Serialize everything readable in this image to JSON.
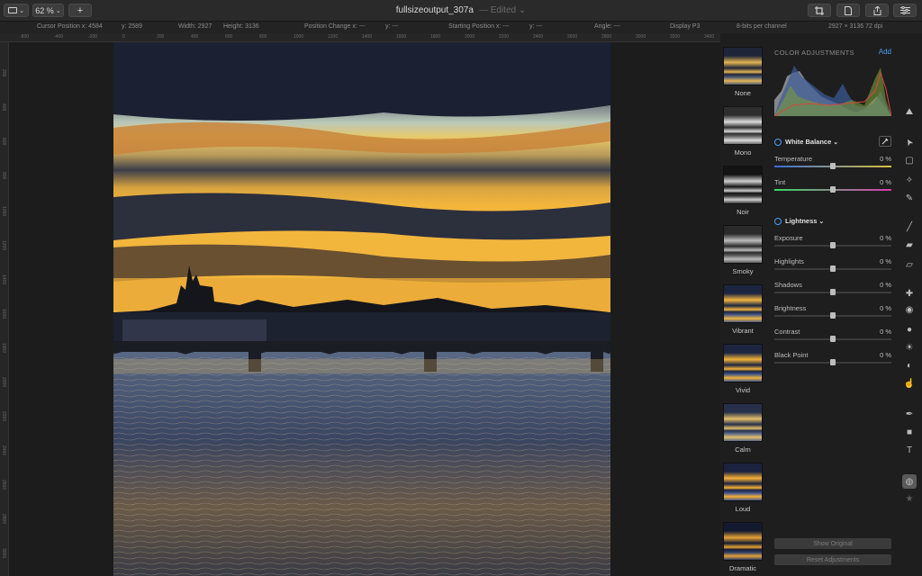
{
  "toolbar": {
    "zoom_label": "62 %",
    "zoom_caret": "⌄",
    "add_label": "+",
    "title": "fullsizeoutput_307a",
    "edited": "— Edited ⌄"
  },
  "info": {
    "cursor": "Cursor Position x: 4584",
    "cursor_y": "y: 2589",
    "width": "Width: 2927",
    "height": "Height: 3136",
    "pos_change": "Position Change x: ---",
    "pos_change_y": "y: ---",
    "start_pos": "Starting Position x: ---",
    "start_pos_y": "y: ---",
    "angle": "Angle: ---",
    "display": "Display P3",
    "bits": "8-bits per channel",
    "dims": "2927 × 3136 72 dpi"
  },
  "ruler": {
    "h": [
      "-800",
      "-400",
      "-200",
      "0",
      "200",
      "400",
      "600",
      "800",
      "1000",
      "1200",
      "1400",
      "1600",
      "1800",
      "2000",
      "2200",
      "2400",
      "2600",
      "2800",
      "3000",
      "3200",
      "3400"
    ],
    "v": [
      "200",
      "400",
      "600",
      "800",
      "1000",
      "1200",
      "1400",
      "1600",
      "1800",
      "2000",
      "2200",
      "2400",
      "2600",
      "2800",
      "3000"
    ]
  },
  "presets": [
    {
      "label": "None"
    },
    {
      "label": "Mono"
    },
    {
      "label": "Noir"
    },
    {
      "label": "Smoky"
    },
    {
      "label": "Vibrant"
    },
    {
      "label": "Vivid"
    },
    {
      "label": "Calm"
    },
    {
      "label": "Loud"
    },
    {
      "label": "Dramatic"
    }
  ],
  "panel": {
    "heading": "COLOR ADJUSTMENTS",
    "add": "Add",
    "white_balance": "White Balance",
    "lightness": "Lightness",
    "wb_sliders": [
      {
        "name": "Temperature",
        "value": "0 %",
        "pos": 0.5
      },
      {
        "name": "Tint",
        "value": "0 %",
        "pos": 0.5
      }
    ],
    "light_sliders": [
      {
        "name": "Exposure",
        "value": "0 %",
        "pos": 0.5
      },
      {
        "name": "Highlights",
        "value": "0 %",
        "pos": 0.5
      },
      {
        "name": "Shadows",
        "value": "0 %",
        "pos": 0.5
      },
      {
        "name": "Brightness",
        "value": "0 %",
        "pos": 0.5
      },
      {
        "name": "Contrast",
        "value": "0 %",
        "pos": 0.5
      },
      {
        "name": "Black Point",
        "value": "0 %",
        "pos": 0.5
      }
    ],
    "show_original": "Show Original",
    "reset": "Reset Adjustments"
  },
  "tools": [
    "paint-icon",
    "arrow-icon",
    "select-rect-icon",
    "magic-wand-icon",
    "pen-icon",
    "brush-icon",
    "bucket-icon",
    "eraser-icon",
    "bandage-icon",
    "clone-icon",
    "blur-icon",
    "sun-icon",
    "burn-icon",
    "smudge-icon",
    "vector-pen-icon",
    "shape-icon",
    "text-icon",
    "color-adjust-icon",
    "star-icon"
  ]
}
